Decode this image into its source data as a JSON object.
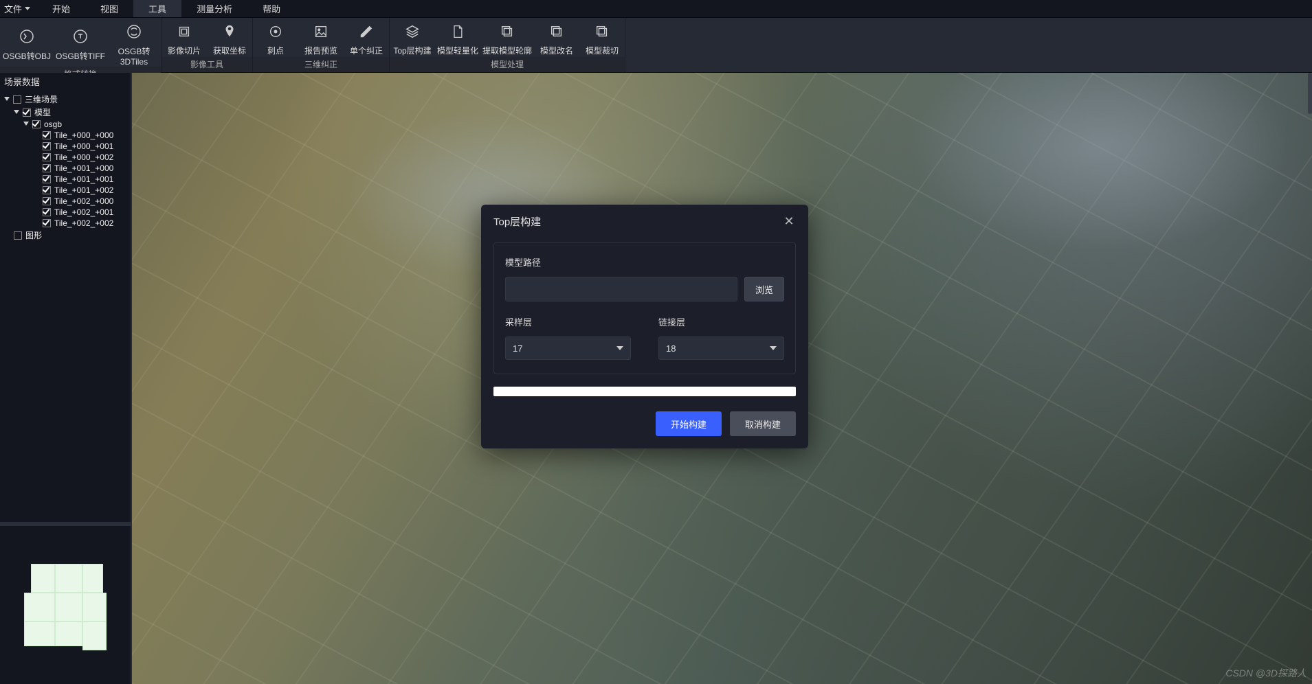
{
  "menubar": {
    "file": "文件",
    "items": [
      "开始",
      "视图",
      "工具",
      "测量分析",
      "帮助"
    ]
  },
  "ribbon": {
    "groups": [
      {
        "name": "格式转换",
        "buttons": [
          {
            "id": "osgb-to-obj",
            "label": "OSGB转OBJ"
          },
          {
            "id": "osgb-to-tiff",
            "label": "OSGB转TIFF"
          },
          {
            "id": "osgb-to-3dtiles",
            "label": "OSGB转3DTiles"
          }
        ]
      },
      {
        "name": "影像工具",
        "buttons": [
          {
            "id": "image-slice",
            "label": "影像切片"
          },
          {
            "id": "get-coord",
            "label": "获取坐标"
          }
        ]
      },
      {
        "name": "三维纠正",
        "buttons": [
          {
            "id": "prick",
            "label": "刺点"
          },
          {
            "id": "report-preview",
            "label": "报告预览"
          },
          {
            "id": "single-correct",
            "label": "单个纠正"
          }
        ]
      },
      {
        "name": "模型处理",
        "buttons": [
          {
            "id": "top-build",
            "label": "Top层构建"
          },
          {
            "id": "model-light",
            "label": "模型轻量化"
          },
          {
            "id": "extract-contour",
            "label": "提取模型轮廓"
          },
          {
            "id": "model-rename",
            "label": "模型改名"
          },
          {
            "id": "model-clip",
            "label": "模型裁切"
          }
        ]
      }
    ]
  },
  "sidebar": {
    "panel_title": "场景数据",
    "root": "三维场景",
    "model": "模型",
    "osgb": "osgb",
    "tiles": [
      "Tile_+000_+000",
      "Tile_+000_+001",
      "Tile_+000_+002",
      "Tile_+001_+000",
      "Tile_+001_+001",
      "Tile_+001_+002",
      "Tile_+002_+000",
      "Tile_+002_+001",
      "Tile_+002_+002"
    ],
    "shapes": "图形"
  },
  "dialog": {
    "title": "Top层构建",
    "model_path_label": "模型路径",
    "model_path_value": "",
    "browse": "浏览",
    "sample_label": "采样层",
    "sample_value": "17",
    "link_label": "链接层",
    "link_value": "18",
    "start": "开始构建",
    "cancel": "取消构建"
  },
  "watermark": "CSDN @3D探路人"
}
